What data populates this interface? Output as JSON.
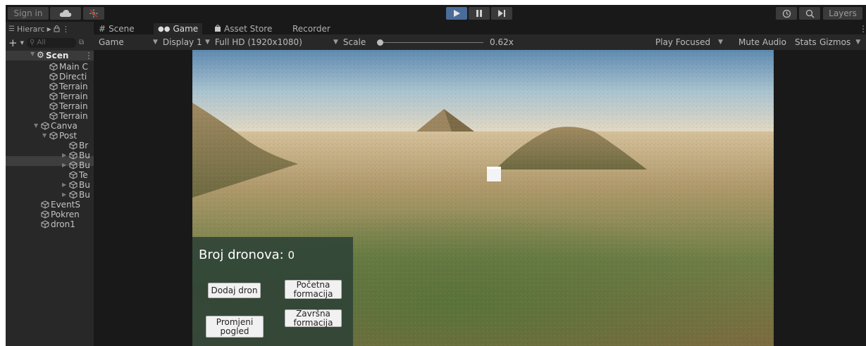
{
  "toolbar": {
    "sign_in": "Sign in",
    "layers": "Layers",
    "icons": [
      "cloud-icon",
      "collab-icon",
      "play-icon",
      "pause-icon",
      "step-icon",
      "history-icon",
      "search-icon"
    ],
    "play_active_color": "#4a6c9a"
  },
  "hierarchy": {
    "tab_label": "Hierarc",
    "search_placeholder": "All",
    "scene": "Scen",
    "items": [
      "Main C",
      "Directi",
      "Terrain",
      "Terrain",
      "Terrain",
      "Terrain",
      "Canva",
      "Post",
      "Br",
      "Bu",
      "Bu",
      "Te",
      "Bu",
      "Bu",
      "EventS",
      "Pokren",
      "dron1"
    ]
  },
  "tabs": [
    "Scene",
    "Game",
    "Asset Store",
    "Recorder"
  ],
  "gamebar": {
    "mode": "Game",
    "display": "Display 1",
    "resolution": "Full HD (1920x1080)",
    "scale_label": "Scale",
    "scale_value": "0.62x",
    "play_focused": "Play Focused",
    "mute": "Mute Audio",
    "stats": "Stats",
    "gizmos": "Gizmos"
  },
  "game_ui": {
    "drone_label": "Broj dronova:",
    "drone_count": "0",
    "add_drone": "Dodaj dron",
    "start_line1": "Početna",
    "start_line2": "formacija",
    "end_line1": "Završna",
    "end_line2": "formacija",
    "view_line1": "Promjeni",
    "view_line2": "pogled"
  }
}
